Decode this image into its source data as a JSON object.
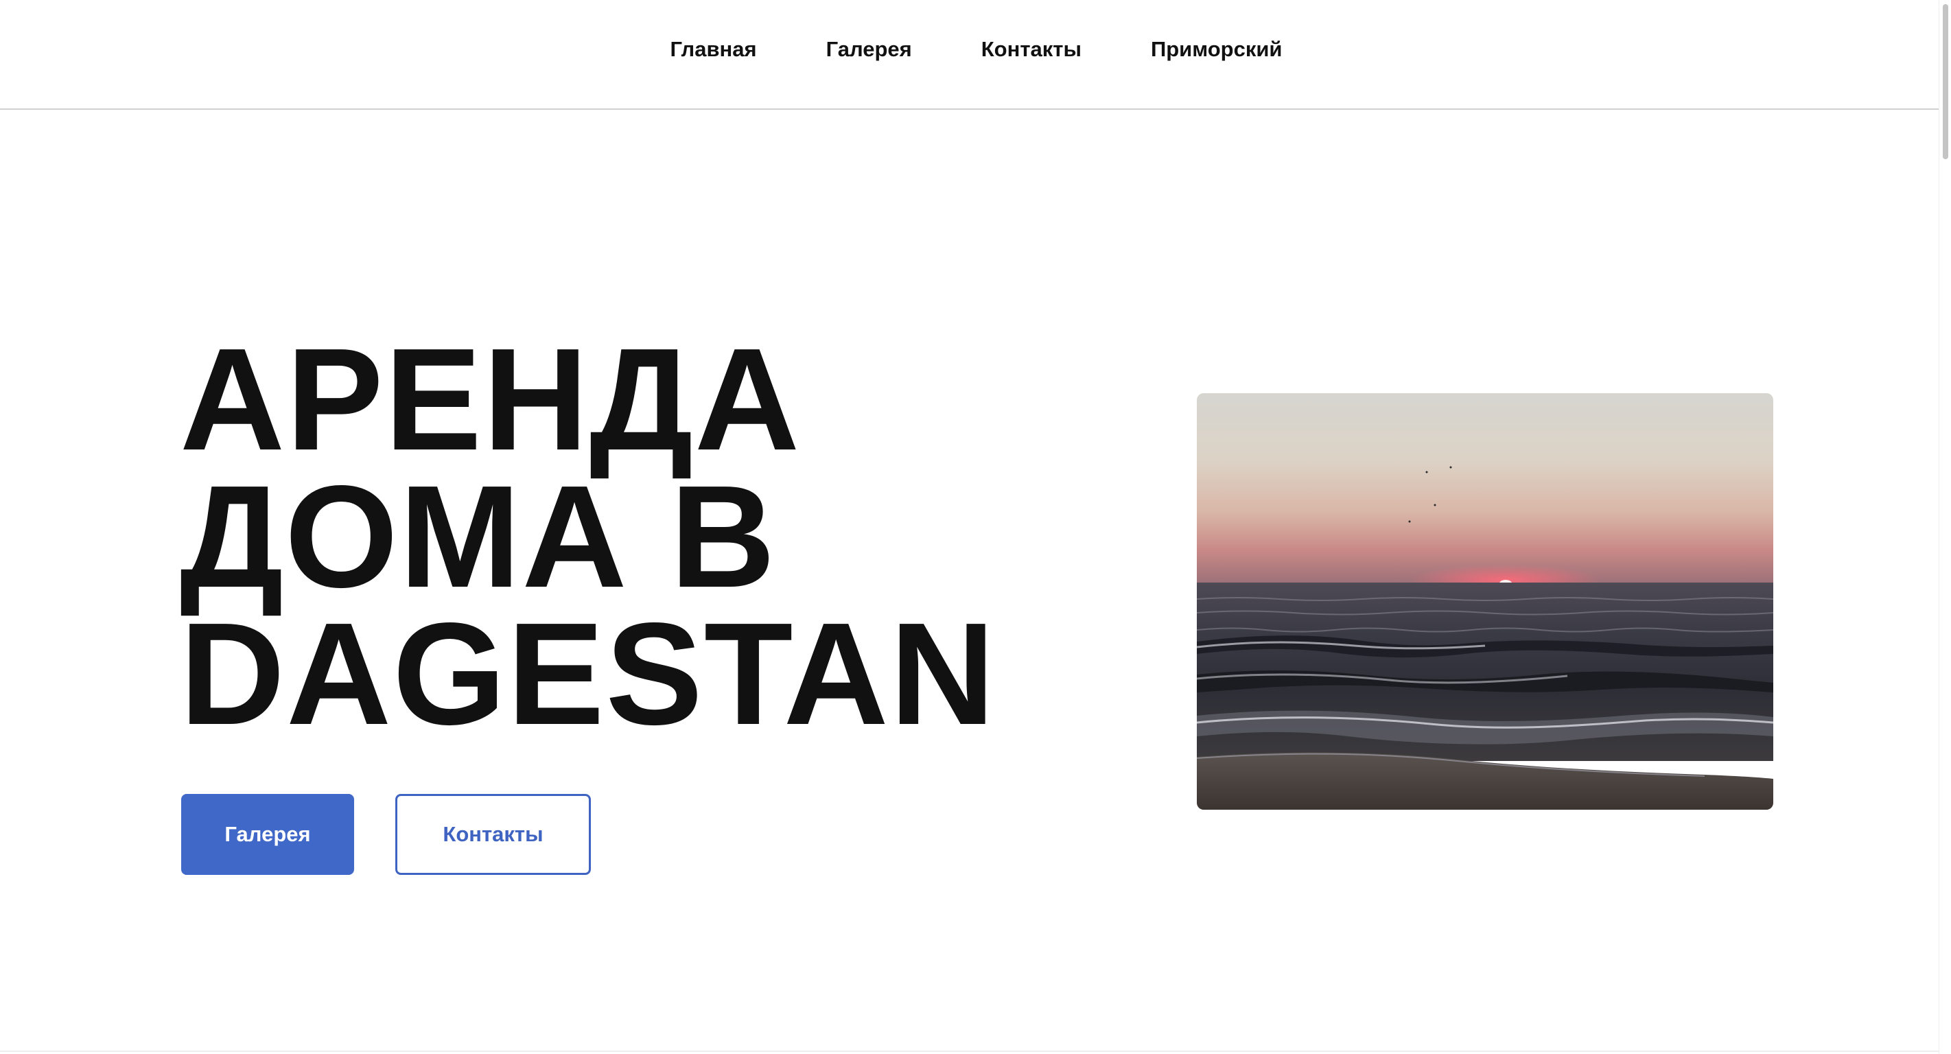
{
  "nav": {
    "items": [
      {
        "label": "Главная"
      },
      {
        "label": "Галерея"
      },
      {
        "label": "Контакты"
      },
      {
        "label": "Приморский"
      }
    ]
  },
  "hero": {
    "title_lines": [
      "АРЕНДА",
      "ДОМА В",
      "DAGESTAN"
    ],
    "primary_button": "Галерея",
    "secondary_button": "Контакты",
    "image": "sea-sunset-photo"
  },
  "colors": {
    "accent": "#4068c8",
    "text": "#111111",
    "background": "#ffffff"
  }
}
